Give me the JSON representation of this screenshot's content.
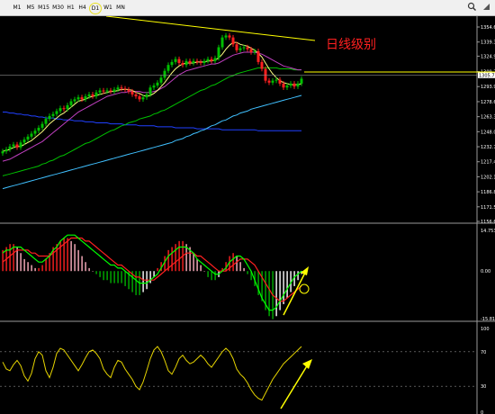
{
  "toolbar": {
    "timeframes": [
      "M1",
      "M5",
      "M15",
      "M30",
      "H1",
      "H4",
      "D1",
      "W1",
      "MN"
    ],
    "active": "D1",
    "icons": [
      "search-icon",
      "window-corner-icon"
    ]
  },
  "annotation": "日线级别",
  "colors": {
    "background": "#000000",
    "bull_candle": "#00c000",
    "bear_candle": "#ff2020",
    "ma_fast": "#ffff80",
    "ma_slow": "#c040c0",
    "ma_long": "#00c000",
    "ma_very_long": "#40c0ff",
    "ma_blue": "#2040ff",
    "annotation_line": "#ffff00",
    "macd_line": "#00ff00",
    "signal_line": "#ff2020"
  },
  "price_axis": {
    "labels": [
      "1354.65",
      "1339.35",
      "1324.95",
      "1309.20",
      "1293.95",
      "1278.60",
      "1263.30",
      "1248.00",
      "1232.70",
      "1217.40",
      "1202.10",
      "1186.80",
      "1171.50",
      "1156.65"
    ],
    "current_price": "1305.77"
  },
  "macd_axis": {
    "labels": [
      "14.753",
      "0.00",
      "-15.8189"
    ]
  },
  "rsi_axis": {
    "labels": [
      "100",
      "70",
      "30",
      "0"
    ]
  },
  "chart_data": [
    {
      "type": "candlestick",
      "panel": "price",
      "ylim": [
        1156.65,
        1354.65
      ],
      "open": [
        1226,
        1228,
        1230,
        1233,
        1235,
        1232,
        1237,
        1240,
        1243,
        1246,
        1249,
        1252,
        1256,
        1261,
        1264,
        1266,
        1269,
        1272,
        1271,
        1275,
        1279,
        1281,
        1283,
        1281,
        1284,
        1286,
        1284,
        1288,
        1290,
        1289,
        1290,
        1289,
        1291,
        1293,
        1292,
        1291,
        1289,
        1286,
        1284,
        1281,
        1283,
        1286,
        1293,
        1295,
        1298,
        1303,
        1310,
        1316,
        1319,
        1322,
        1318,
        1316,
        1320,
        1318,
        1320,
        1319,
        1318,
        1320,
        1322,
        1320,
        1323,
        1334,
        1344,
        1346,
        1344,
        1337,
        1331,
        1333,
        1334,
        1332,
        1329,
        1330,
        1319,
        1312,
        1300,
        1298,
        1300,
        1301,
        1297,
        1293,
        1295,
        1297,
        1294,
        1297
      ],
      "close": [
        1228,
        1230,
        1233,
        1235,
        1232,
        1237,
        1240,
        1243,
        1246,
        1249,
        1252,
        1256,
        1261,
        1264,
        1266,
        1269,
        1272,
        1271,
        1275,
        1279,
        1281,
        1283,
        1281,
        1284,
        1286,
        1284,
        1288,
        1290,
        1289,
        1290,
        1289,
        1291,
        1293,
        1292,
        1291,
        1289,
        1286,
        1284,
        1281,
        1283,
        1286,
        1293,
        1295,
        1298,
        1303,
        1310,
        1316,
        1319,
        1322,
        1318,
        1316,
        1320,
        1318,
        1320,
        1319,
        1318,
        1320,
        1322,
        1320,
        1323,
        1334,
        1344,
        1346,
        1344,
        1337,
        1331,
        1333,
        1334,
        1332,
        1329,
        1330,
        1319,
        1312,
        1300,
        1298,
        1300,
        1301,
        1297,
        1293,
        1295,
        1297,
        1294,
        1297,
        1302
      ],
      "ma_fast": [
        1228,
        1229,
        1230,
        1232,
        1233,
        1233,
        1235,
        1237,
        1239,
        1242,
        1245,
        1248,
        1252,
        1256,
        1259,
        1262,
        1265,
        1267,
        1270,
        1273,
        1276,
        1279,
        1280,
        1281,
        1283,
        1284,
        1285,
        1286,
        1287,
        1288,
        1289,
        1289,
        1290,
        1291,
        1291,
        1291,
        1290,
        1288,
        1287,
        1285,
        1284,
        1285,
        1287,
        1290,
        1294,
        1298,
        1303,
        1308,
        1312,
        1315,
        1317,
        1318,
        1318,
        1318,
        1319,
        1319,
        1319,
        1320,
        1320,
        1321,
        1323,
        1327,
        1332,
        1336,
        1339,
        1339,
        1337,
        1336,
        1335,
        1333,
        1331,
        1328,
        1324,
        1318,
        1312,
        1307,
        1303,
        1300,
        1298,
        1297,
        1296,
        1296,
        1296,
        1297
      ],
      "ma_slow": [
        1218,
        1219,
        1220,
        1222,
        1224,
        1226,
        1228,
        1230,
        1232,
        1234,
        1236,
        1238,
        1241,
        1244,
        1247,
        1250,
        1253,
        1256,
        1259,
        1262,
        1265,
        1268,
        1270,
        1272,
        1274,
        1276,
        1278,
        1280,
        1282,
        1284,
        1285,
        1286,
        1287,
        1288,
        1288,
        1289,
        1289,
        1289,
        1289,
        1288,
        1288,
        1288,
        1289,
        1290,
        1292,
        1294,
        1297,
        1300,
        1303,
        1306,
        1308,
        1310,
        1311,
        1312,
        1313,
        1314,
        1315,
        1316,
        1317,
        1317,
        1318,
        1320,
        1322,
        1324,
        1326,
        1327,
        1328,
        1329,
        1329,
        1329,
        1329,
        1328,
        1327,
        1325,
        1323,
        1321,
        1319,
        1317,
        1315,
        1314,
        1313,
        1312,
        1311,
        1311
      ],
      "ma_long": [
        1203,
        1204,
        1205,
        1206,
        1207,
        1208,
        1209,
        1210,
        1211,
        1212,
        1213,
        1215,
        1216,
        1218,
        1219,
        1221,
        1223,
        1224,
        1226,
        1228,
        1230,
        1232,
        1234,
        1236,
        1237,
        1239,
        1241,
        1243,
        1245,
        1247,
        1249,
        1250,
        1252,
        1254,
        1255,
        1257,
        1258,
        1259,
        1261,
        1262,
        1263,
        1264,
        1266,
        1267,
        1269,
        1270,
        1272,
        1274,
        1276,
        1278,
        1280,
        1282,
        1284,
        1286,
        1288,
        1290,
        1291,
        1293,
        1295,
        1296,
        1298,
        1300,
        1302,
        1304,
        1305,
        1307,
        1308,
        1309,
        1310,
        1311,
        1312,
        1313,
        1313,
        1313,
        1313,
        1313,
        1313,
        1312,
        1312,
        1312,
        1312,
        1311,
        1311,
        1311
      ],
      "ma_very_long": [
        1190,
        1191,
        1192,
        1193,
        1194,
        1195,
        1196,
        1197,
        1198,
        1199,
        1200,
        1201,
        1202,
        1203,
        1204,
        1205,
        1206,
        1207,
        1208,
        1209,
        1210,
        1211,
        1212,
        1213,
        1214,
        1215,
        1216,
        1217,
        1218,
        1219,
        1220,
        1221,
        1222,
        1223,
        1224,
        1225,
        1226,
        1227,
        1228,
        1229,
        1230,
        1231,
        1232,
        1233,
        1234,
        1235,
        1236,
        1237,
        1239,
        1240,
        1241,
        1243,
        1244,
        1246,
        1247,
        1249,
        1250,
        1252,
        1254,
        1255,
        1257,
        1259,
        1260,
        1262,
        1264,
        1265,
        1267,
        1268,
        1269,
        1271,
        1272,
        1273,
        1274,
        1275,
        1276,
        1277,
        1278,
        1279,
        1280,
        1281,
        1282,
        1283,
        1284,
        1285
      ],
      "ma_blue": [
        1268,
        1268,
        1267,
        1267,
        1266,
        1266,
        1265,
        1265,
        1264,
        1264,
        1263,
        1263,
        1262,
        1262,
        1262,
        1261,
        1261,
        1260,
        1260,
        1260,
        1259,
        1259,
        1259,
        1258,
        1258,
        1258,
        1257,
        1257,
        1257,
        1257,
        1256,
        1256,
        1256,
        1256,
        1255,
        1255,
        1255,
        1255,
        1254,
        1254,
        1254,
        1254,
        1254,
        1253,
        1253,
        1253,
        1253,
        1253,
        1252,
        1252,
        1252,
        1252,
        1252,
        1252,
        1251,
        1251,
        1251,
        1251,
        1251,
        1251,
        1251,
        1250,
        1250,
        1250,
        1250,
        1250,
        1250,
        1250,
        1250,
        1250,
        1250,
        1249,
        1249,
        1249,
        1249,
        1249,
        1249,
        1249,
        1249,
        1249,
        1249,
        1249,
        1249,
        1249
      ]
    },
    {
      "type": "bar",
      "panel": "macd",
      "ylim": [
        -15.8189,
        14.753
      ],
      "histogram": [
        7,
        8,
        9,
        9,
        8,
        6,
        4,
        3,
        2,
        1,
        1,
        2,
        4,
        6,
        8,
        9,
        10,
        11,
        11,
        10,
        9,
        7,
        5,
        3,
        1,
        0,
        -1,
        -2,
        -3,
        -3,
        -4,
        -4,
        -4,
        -4,
        -5,
        -6,
        -7,
        -8,
        -8,
        -7,
        -6,
        -4,
        -2,
        1,
        3,
        5,
        7,
        8,
        9,
        10,
        10,
        9,
        8,
        6,
        4,
        2,
        0,
        -2,
        -3,
        -3,
        -2,
        1,
        3,
        5,
        6,
        5,
        3,
        1,
        -1,
        -3,
        -5,
        -8,
        -10,
        -13,
        -15,
        -16,
        -15,
        -13,
        -11,
        -9,
        -7,
        -5,
        -3,
        -1
      ],
      "macd_line": [
        6,
        7,
        7,
        8,
        8,
        8,
        7,
        6,
        5,
        4,
        3,
        3,
        4,
        5,
        7,
        8,
        10,
        11,
        12,
        12,
        12,
        11,
        10,
        9,
        8,
        7,
        6,
        5,
        4,
        3,
        2,
        2,
        1,
        1,
        0,
        -1,
        -2,
        -3,
        -4,
        -4,
        -4,
        -3,
        -2,
        -1,
        1,
        3,
        5,
        6,
        7,
        8,
        8,
        8,
        7,
        6,
        4,
        3,
        2,
        1,
        0,
        -1,
        -1,
        0,
        1,
        3,
        4,
        5,
        5,
        4,
        2,
        0,
        -3,
        -6,
        -9,
        -11,
        -13,
        -13,
        -12,
        -10,
        -8,
        -6,
        -4,
        -2,
        -1,
        0
      ],
      "signal_line": [
        3,
        4,
        5,
        6,
        7,
        7,
        7,
        7,
        6,
        6,
        5,
        5,
        5,
        5,
        6,
        7,
        8,
        9,
        10,
        11,
        11,
        11,
        11,
        10,
        10,
        9,
        8,
        7,
        6,
        5,
        4,
        3,
        2,
        2,
        1,
        0,
        -1,
        -2,
        -2,
        -3,
        -3,
        -3,
        -3,
        -2,
        -1,
        0,
        1,
        2,
        3,
        4,
        5,
        6,
        6,
        6,
        5,
        5,
        4,
        3,
        2,
        1,
        0,
        0,
        0,
        1,
        2,
        3,
        4,
        4,
        4,
        3,
        2,
        0,
        -2,
        -4,
        -6,
        -8,
        -9,
        -10,
        -10,
        -9,
        -8,
        -7,
        -6,
        -5
      ]
    },
    {
      "type": "line",
      "panel": "rsi",
      "ylim": [
        0,
        100
      ],
      "values": [
        58,
        50,
        48,
        55,
        60,
        54,
        42,
        36,
        45,
        62,
        70,
        66,
        48,
        40,
        52,
        68,
        74,
        72,
        66,
        60,
        54,
        48,
        55,
        63,
        70,
        72,
        68,
        62,
        50,
        44,
        40,
        52,
        60,
        58,
        50,
        44,
        38,
        30,
        26,
        35,
        48,
        62,
        72,
        76,
        70,
        60,
        48,
        44,
        52,
        62,
        66,
        60,
        56,
        58,
        62,
        66,
        62,
        56,
        52,
        58,
        64,
        70,
        74,
        70,
        62,
        50,
        44,
        40,
        34,
        26,
        20,
        16,
        14,
        22,
        30,
        38,
        44,
        50,
        56,
        60,
        64,
        68,
        72,
        76
      ]
    }
  ]
}
